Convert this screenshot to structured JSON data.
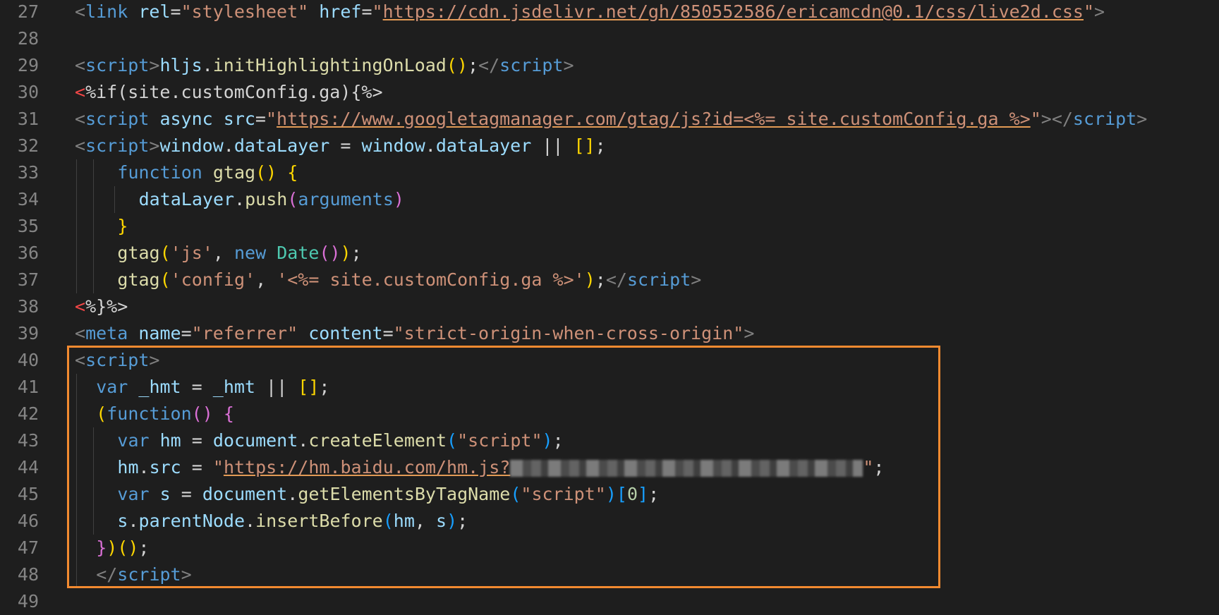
{
  "editor": {
    "lines": [
      {
        "num": "27",
        "tokens": [
          {
            "t": "<",
            "c": "#808080"
          },
          {
            "t": "link",
            "c": "#569cd6"
          },
          {
            "t": " ",
            "c": "#d4d4d4"
          },
          {
            "t": "rel",
            "c": "#9cdcfe"
          },
          {
            "t": "=",
            "c": "#d4d4d4"
          },
          {
            "t": "\"stylesheet\"",
            "c": "#ce9178"
          },
          {
            "t": " ",
            "c": "#d4d4d4"
          },
          {
            "t": "href",
            "c": "#9cdcfe"
          },
          {
            "t": "=",
            "c": "#d4d4d4"
          },
          {
            "t": "\"",
            "c": "#ce9178"
          },
          {
            "t": "https://cdn.jsdelivr.net/gh/850552586/ericamcdn@0.1/css/live2d.css",
            "c": "#ce9178",
            "u": true
          },
          {
            "t": "\"",
            "c": "#ce9178"
          },
          {
            "t": ">",
            "c": "#808080"
          }
        ]
      },
      {
        "num": "28",
        "tokens": []
      },
      {
        "num": "29",
        "tokens": [
          {
            "t": "<",
            "c": "#808080"
          },
          {
            "t": "script",
            "c": "#569cd6"
          },
          {
            "t": ">",
            "c": "#808080"
          },
          {
            "t": "hljs",
            "c": "#9cdcfe"
          },
          {
            "t": ".",
            "c": "#d4d4d4"
          },
          {
            "t": "initHighlightingOnLoad",
            "c": "#dcdcaa"
          },
          {
            "t": "()",
            "c": "#ffd700"
          },
          {
            "t": ";",
            "c": "#d4d4d4"
          },
          {
            "t": "</",
            "c": "#808080"
          },
          {
            "t": "script",
            "c": "#569cd6"
          },
          {
            "t": ">",
            "c": "#808080"
          }
        ]
      },
      {
        "num": "30",
        "tokens": [
          {
            "t": "<",
            "c": "#f44747"
          },
          {
            "t": "%if(site.customConfig.ga){%>",
            "c": "#d4d4d4"
          }
        ]
      },
      {
        "num": "31",
        "tokens": [
          {
            "t": "<",
            "c": "#808080"
          },
          {
            "t": "script",
            "c": "#569cd6"
          },
          {
            "t": " ",
            "c": "#d4d4d4"
          },
          {
            "t": "async",
            "c": "#9cdcfe"
          },
          {
            "t": " ",
            "c": "#d4d4d4"
          },
          {
            "t": "src",
            "c": "#9cdcfe"
          },
          {
            "t": "=",
            "c": "#d4d4d4"
          },
          {
            "t": "\"",
            "c": "#ce9178"
          },
          {
            "t": "https://www.googletagmanager.com/gtag/js?id=<%= site.customConfig.ga %>",
            "c": "#ce9178",
            "u": true
          },
          {
            "t": "\"",
            "c": "#ce9178"
          },
          {
            "t": ">",
            "c": "#808080"
          },
          {
            "t": "</",
            "c": "#808080"
          },
          {
            "t": "script",
            "c": "#569cd6"
          },
          {
            "t": ">",
            "c": "#808080"
          }
        ]
      },
      {
        "num": "32",
        "tokens": [
          {
            "t": "<",
            "c": "#808080"
          },
          {
            "t": "script",
            "c": "#569cd6"
          },
          {
            "t": ">",
            "c": "#808080"
          },
          {
            "t": "window",
            "c": "#9cdcfe"
          },
          {
            "t": ".",
            "c": "#d4d4d4"
          },
          {
            "t": "dataLayer",
            "c": "#9cdcfe"
          },
          {
            "t": " = ",
            "c": "#d4d4d4"
          },
          {
            "t": "window",
            "c": "#9cdcfe"
          },
          {
            "t": ".",
            "c": "#d4d4d4"
          },
          {
            "t": "dataLayer",
            "c": "#9cdcfe"
          },
          {
            "t": " || ",
            "c": "#d4d4d4"
          },
          {
            "t": "[]",
            "c": "#ffd700"
          },
          {
            "t": ";",
            "c": "#d4d4d4"
          }
        ]
      },
      {
        "num": "33",
        "indent": 4,
        "tokens": [
          {
            "t": "function",
            "c": "#569cd6"
          },
          {
            "t": " ",
            "c": "#d4d4d4"
          },
          {
            "t": "gtag",
            "c": "#dcdcaa"
          },
          {
            "t": "()",
            "c": "#ffd700"
          },
          {
            "t": " ",
            "c": "#d4d4d4"
          },
          {
            "t": "{",
            "c": "#ffd700"
          }
        ]
      },
      {
        "num": "34",
        "indent": 6,
        "tokens": [
          {
            "t": "dataLayer",
            "c": "#9cdcfe"
          },
          {
            "t": ".",
            "c": "#d4d4d4"
          },
          {
            "t": "push",
            "c": "#dcdcaa"
          },
          {
            "t": "(",
            "c": "#da70d6"
          },
          {
            "t": "arguments",
            "c": "#569cd6"
          },
          {
            "t": ")",
            "c": "#da70d6"
          }
        ]
      },
      {
        "num": "35",
        "indent": 4,
        "tokens": [
          {
            "t": "}",
            "c": "#ffd700"
          }
        ]
      },
      {
        "num": "36",
        "indent": 4,
        "tokens": [
          {
            "t": "gtag",
            "c": "#dcdcaa"
          },
          {
            "t": "(",
            "c": "#ffd700"
          },
          {
            "t": "'js'",
            "c": "#ce9178"
          },
          {
            "t": ", ",
            "c": "#d4d4d4"
          },
          {
            "t": "new",
            "c": "#569cd6"
          },
          {
            "t": " ",
            "c": "#d4d4d4"
          },
          {
            "t": "Date",
            "c": "#4ec9b0"
          },
          {
            "t": "()",
            "c": "#da70d6"
          },
          {
            "t": ")",
            "c": "#ffd700"
          },
          {
            "t": ";",
            "c": "#d4d4d4"
          }
        ]
      },
      {
        "num": "37",
        "indent": 4,
        "tokens": [
          {
            "t": "gtag",
            "c": "#dcdcaa"
          },
          {
            "t": "(",
            "c": "#ffd700"
          },
          {
            "t": "'config'",
            "c": "#ce9178"
          },
          {
            "t": ", ",
            "c": "#d4d4d4"
          },
          {
            "t": "'<%= site.customConfig.ga %>'",
            "c": "#ce9178"
          },
          {
            "t": ")",
            "c": "#ffd700"
          },
          {
            "t": ";",
            "c": "#d4d4d4"
          },
          {
            "t": "</",
            "c": "#808080"
          },
          {
            "t": "script",
            "c": "#569cd6"
          },
          {
            "t": ">",
            "c": "#808080"
          }
        ]
      },
      {
        "num": "38",
        "tokens": [
          {
            "t": "<",
            "c": "#f44747"
          },
          {
            "t": "%}%>",
            "c": "#d4d4d4"
          }
        ]
      },
      {
        "num": "39",
        "tokens": [
          {
            "t": "<",
            "c": "#808080"
          },
          {
            "t": "meta",
            "c": "#569cd6"
          },
          {
            "t": " ",
            "c": "#d4d4d4"
          },
          {
            "t": "name",
            "c": "#9cdcfe"
          },
          {
            "t": "=",
            "c": "#d4d4d4"
          },
          {
            "t": "\"referrer\"",
            "c": "#ce9178"
          },
          {
            "t": " ",
            "c": "#d4d4d4"
          },
          {
            "t": "content",
            "c": "#9cdcfe"
          },
          {
            "t": "=",
            "c": "#d4d4d4"
          },
          {
            "t": "\"strict-origin-when-cross-origin\"",
            "c": "#ce9178"
          },
          {
            "t": ">",
            "c": "#808080"
          }
        ]
      },
      {
        "num": "40",
        "tokens": [
          {
            "t": "<",
            "c": "#808080"
          },
          {
            "t": "script",
            "c": "#569cd6"
          },
          {
            "t": ">",
            "c": "#808080"
          }
        ]
      },
      {
        "num": "41",
        "indent": 2,
        "tokens": [
          {
            "t": "var",
            "c": "#569cd6"
          },
          {
            "t": " ",
            "c": "#d4d4d4"
          },
          {
            "t": "_hmt",
            "c": "#9cdcfe"
          },
          {
            "t": " = ",
            "c": "#d4d4d4"
          },
          {
            "t": "_hmt",
            "c": "#9cdcfe"
          },
          {
            "t": " || ",
            "c": "#d4d4d4"
          },
          {
            "t": "[]",
            "c": "#ffd700"
          },
          {
            "t": ";",
            "c": "#d4d4d4"
          }
        ]
      },
      {
        "num": "42",
        "indent": 2,
        "tokens": [
          {
            "t": "(",
            "c": "#ffd700"
          },
          {
            "t": "function",
            "c": "#569cd6"
          },
          {
            "t": "()",
            "c": "#da70d6"
          },
          {
            "t": " ",
            "c": "#d4d4d4"
          },
          {
            "t": "{",
            "c": "#da70d6"
          }
        ]
      },
      {
        "num": "43",
        "indent": 4,
        "tokens": [
          {
            "t": "var",
            "c": "#569cd6"
          },
          {
            "t": " ",
            "c": "#d4d4d4"
          },
          {
            "t": "hm",
            "c": "#9cdcfe"
          },
          {
            "t": " = ",
            "c": "#d4d4d4"
          },
          {
            "t": "document",
            "c": "#9cdcfe"
          },
          {
            "t": ".",
            "c": "#d4d4d4"
          },
          {
            "t": "createElement",
            "c": "#dcdcaa"
          },
          {
            "t": "(",
            "c": "#179fff"
          },
          {
            "t": "\"script\"",
            "c": "#ce9178"
          },
          {
            "t": ")",
            "c": "#179fff"
          },
          {
            "t": ";",
            "c": "#d4d4d4"
          }
        ]
      },
      {
        "num": "44",
        "indent": 4,
        "tokens": [
          {
            "t": "hm",
            "c": "#9cdcfe"
          },
          {
            "t": ".",
            "c": "#d4d4d4"
          },
          {
            "t": "src",
            "c": "#9cdcfe"
          },
          {
            "t": " = ",
            "c": "#d4d4d4"
          },
          {
            "t": "\"",
            "c": "#ce9178"
          },
          {
            "t": "https://hm.baidu.com/hm.js?",
            "c": "#ce9178",
            "u": true
          },
          {
            "redacted": true
          },
          {
            "t": "\"",
            "c": "#ce9178"
          },
          {
            "t": ";",
            "c": "#d4d4d4"
          }
        ]
      },
      {
        "num": "45",
        "indent": 4,
        "tokens": [
          {
            "t": "var",
            "c": "#569cd6"
          },
          {
            "t": " ",
            "c": "#d4d4d4"
          },
          {
            "t": "s",
            "c": "#9cdcfe"
          },
          {
            "t": " = ",
            "c": "#d4d4d4"
          },
          {
            "t": "document",
            "c": "#9cdcfe"
          },
          {
            "t": ".",
            "c": "#d4d4d4"
          },
          {
            "t": "getElementsByTagName",
            "c": "#dcdcaa"
          },
          {
            "t": "(",
            "c": "#179fff"
          },
          {
            "t": "\"script\"",
            "c": "#ce9178"
          },
          {
            "t": ")",
            "c": "#179fff"
          },
          {
            "t": "[",
            "c": "#179fff"
          },
          {
            "t": "0",
            "c": "#b5cea8"
          },
          {
            "t": "]",
            "c": "#179fff"
          },
          {
            "t": ";",
            "c": "#d4d4d4"
          }
        ]
      },
      {
        "num": "46",
        "indent": 4,
        "tokens": [
          {
            "t": "s",
            "c": "#9cdcfe"
          },
          {
            "t": ".",
            "c": "#d4d4d4"
          },
          {
            "t": "parentNode",
            "c": "#9cdcfe"
          },
          {
            "t": ".",
            "c": "#d4d4d4"
          },
          {
            "t": "insertBefore",
            "c": "#dcdcaa"
          },
          {
            "t": "(",
            "c": "#179fff"
          },
          {
            "t": "hm",
            "c": "#9cdcfe"
          },
          {
            "t": ", ",
            "c": "#d4d4d4"
          },
          {
            "t": "s",
            "c": "#9cdcfe"
          },
          {
            "t": ")",
            "c": "#179fff"
          },
          {
            "t": ";",
            "c": "#d4d4d4"
          }
        ]
      },
      {
        "num": "47",
        "indent": 2,
        "tokens": [
          {
            "t": "}",
            "c": "#da70d6"
          },
          {
            "t": ")",
            "c": "#ffd700"
          },
          {
            "t": "()",
            "c": "#ffd700"
          },
          {
            "t": ";",
            "c": "#d4d4d4"
          }
        ]
      },
      {
        "num": "48",
        "indent": 2,
        "tokens": [
          {
            "t": "</",
            "c": "#808080"
          },
          {
            "t": "script",
            "c": "#569cd6"
          },
          {
            "t": ">",
            "c": "#808080"
          }
        ]
      },
      {
        "num": "49",
        "tokens": []
      }
    ]
  },
  "highlight": {
    "color": "#f28a30",
    "first_line": "40",
    "last_line": "48"
  }
}
